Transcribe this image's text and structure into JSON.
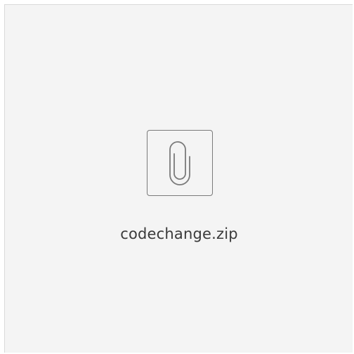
{
  "attachment": {
    "file_name": "codechange.zip",
    "icon": "paperclip-icon"
  },
  "colors": {
    "card_background": "#f4f4f4",
    "icon_stroke": "#7a7a7a",
    "text": "#3a3a3a"
  }
}
